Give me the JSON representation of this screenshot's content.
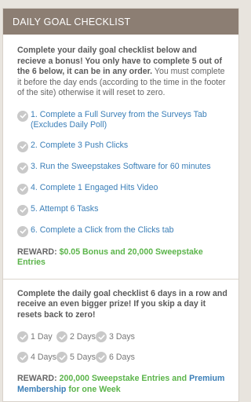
{
  "header": {
    "title": "DAILY GOAL CHECKLIST"
  },
  "daily": {
    "intro_bold": "Complete your daily goal checklist below and recieve a bonus! You only have to complete 5 out of the 6 below, it can be in any order.",
    "intro_rest": " You must complete it before the day ends (according to the time in the footer of the site) otherwise it will reset to zero.",
    "tasks": [
      "1. Complete a Full Survey from the Surveys Tab (Excludes Daily Poll)",
      "2. Complete 3 Push Clicks",
      "3. Run the Sweepstakes Software for 60 minutes",
      "4. Complete 1 Engaged Hits Video",
      "5. Attempt 6 Tasks",
      "6. Complete a Click from the Clicks tab"
    ],
    "reward_label": "REWARD:",
    "reward_value": "$0.05 Bonus and 20,000 Sweepstake Entries"
  },
  "streak": {
    "intro": "Complete the daily goal checklist 6 days in a row and receive an even bigger prize! If you skip a day it resets back to zero!",
    "days": [
      "1 Day",
      "2 Days",
      "3 Days",
      "4 Days",
      "5 Days",
      "6 Days"
    ],
    "reward_label": "REWARD:",
    "reward_green": "200,000 Sweepstake Entries and",
    "reward_blue_1": "Premium",
    "reward_blue_2": "Membership",
    "reward_green_2": "for one Week"
  },
  "icons": {
    "check": "check-circle-icon"
  },
  "colors": {
    "header_bg": "#8c7e73",
    "link": "#3b7fb8",
    "reward_green": "#5bb44a",
    "check_bg": "#c9c9c9"
  }
}
